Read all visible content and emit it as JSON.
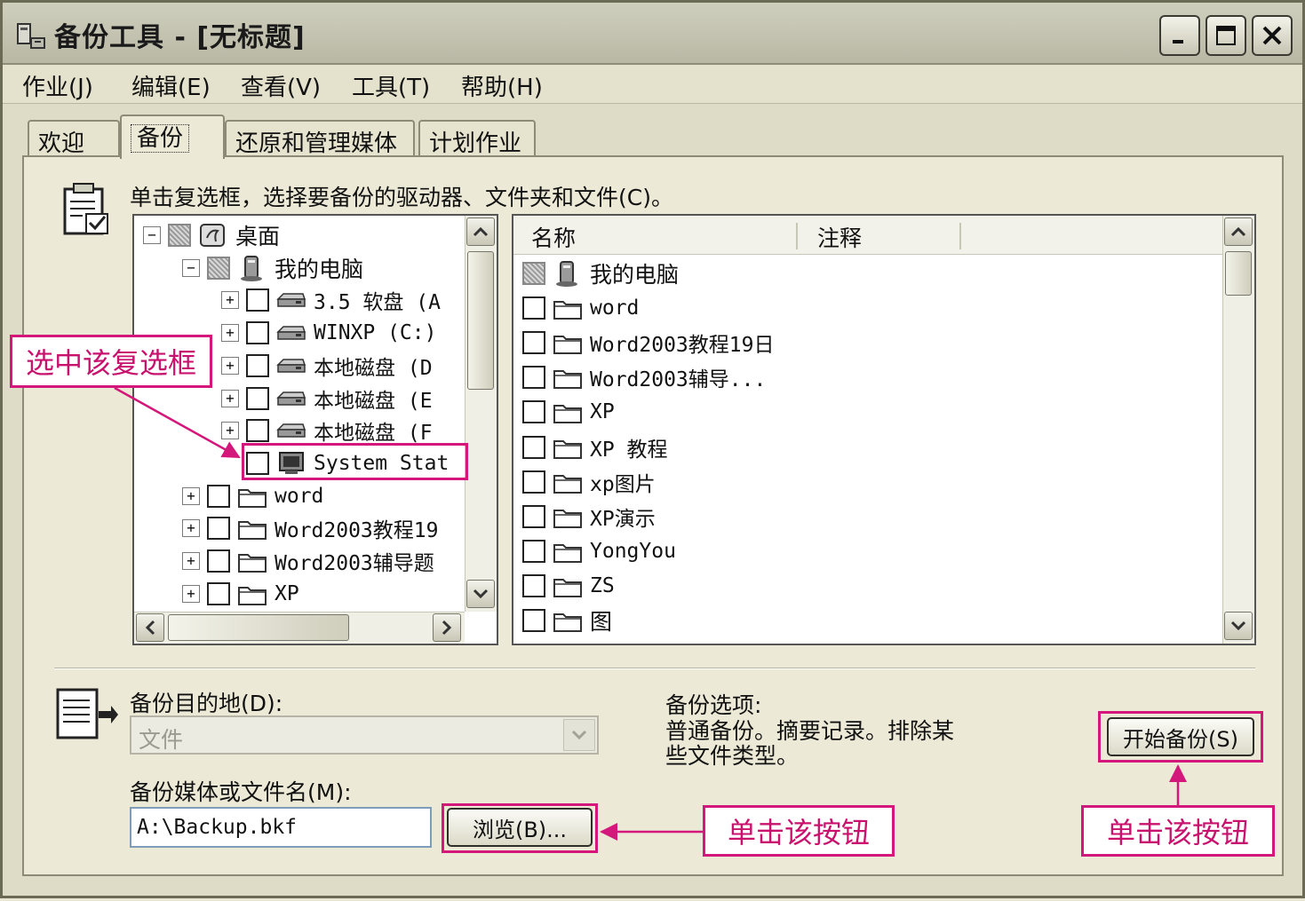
{
  "window": {
    "title": "备份工具 - [无标题]",
    "controls": [
      "minimize",
      "maximize",
      "close"
    ]
  },
  "menu": [
    "作业(J)",
    "编辑(E)",
    "查看(V)",
    "工具(T)",
    "帮助(H)"
  ],
  "tabs": [
    "欢迎",
    "备份",
    "还原和管理媒体",
    "计划作业"
  ],
  "active_tab": "备份",
  "instruction": "单击复选框，选择要备份的驱动器、文件夹和文件(C)。",
  "tree": [
    {
      "label": "桌面",
      "level": 0,
      "expander": "−",
      "check": "partial",
      "icon": "desktop-icon"
    },
    {
      "label": "我的电脑",
      "level": 1,
      "expander": "−",
      "check": "partial",
      "icon": "computer-icon"
    },
    {
      "label": "3.5 软盘 (A",
      "level": 2,
      "expander": "+",
      "check": "empty",
      "icon": "drive-icon"
    },
    {
      "label": "WINXP (C:)",
      "level": 2,
      "expander": "+",
      "check": "empty",
      "icon": "drive-icon"
    },
    {
      "label": "本地磁盘 (D",
      "level": 2,
      "expander": "+",
      "check": "empty",
      "icon": "drive-icon"
    },
    {
      "label": "本地磁盘 (E",
      "level": 2,
      "expander": "+",
      "check": "empty",
      "icon": "drive-icon"
    },
    {
      "label": "本地磁盘 (F",
      "level": 2,
      "expander": "+",
      "check": "empty",
      "icon": "drive-icon"
    },
    {
      "label": "System Stat",
      "level": 2,
      "expander": "",
      "check": "empty",
      "icon": "system-state-icon"
    },
    {
      "label": "word",
      "level": 1,
      "expander": "+",
      "check": "empty",
      "icon": "folder-icon"
    },
    {
      "label": "Word2003教程19",
      "level": 1,
      "expander": "+",
      "check": "empty",
      "icon": "folder-icon"
    },
    {
      "label": "Word2003辅导题",
      "level": 1,
      "expander": "+",
      "check": "empty",
      "icon": "folder-icon"
    },
    {
      "label": "XP",
      "level": 1,
      "expander": "+",
      "check": "empty",
      "icon": "folder-icon"
    }
  ],
  "list": {
    "columns": [
      "名称",
      "注释"
    ],
    "rows": [
      {
        "name": "我的电脑",
        "check": "partial",
        "icon": "computer-icon"
      },
      {
        "name": "word",
        "check": "empty",
        "icon": "folder-icon"
      },
      {
        "name": "Word2003教程19日",
        "check": "empty",
        "icon": "folder-icon"
      },
      {
        "name": "Word2003辅导...",
        "check": "empty",
        "icon": "folder-icon"
      },
      {
        "name": "XP",
        "check": "empty",
        "icon": "folder-icon"
      },
      {
        "name": "XP 教程",
        "check": "empty",
        "icon": "folder-icon"
      },
      {
        "name": "xp图片",
        "check": "empty",
        "icon": "folder-icon"
      },
      {
        "name": "XP演示",
        "check": "empty",
        "icon": "folder-icon"
      },
      {
        "name": "YongYou",
        "check": "empty",
        "icon": "folder-icon"
      },
      {
        "name": "ZS",
        "check": "empty",
        "icon": "folder-icon"
      },
      {
        "name": "图",
        "check": "empty",
        "icon": "folder-icon"
      }
    ]
  },
  "destination": {
    "label": "备份目的地(D):",
    "value": "文件"
  },
  "media": {
    "label": "备份媒体或文件名(M):",
    "value": "A:\\Backup.bkf"
  },
  "browse_button": "浏览(B)...",
  "options": {
    "label": "备份选项:",
    "line1": "普通备份。摘要记录。排除某",
    "line2": "些文件类型。"
  },
  "start_button": "开始备份(S)",
  "annotations": {
    "checkbox_callout": "选中该复选框",
    "browse_callout": "单击该按钮",
    "start_callout": "单击该按钮"
  },
  "colors": {
    "annotation": "#d4177a",
    "window_bg": "#ece9d6"
  }
}
